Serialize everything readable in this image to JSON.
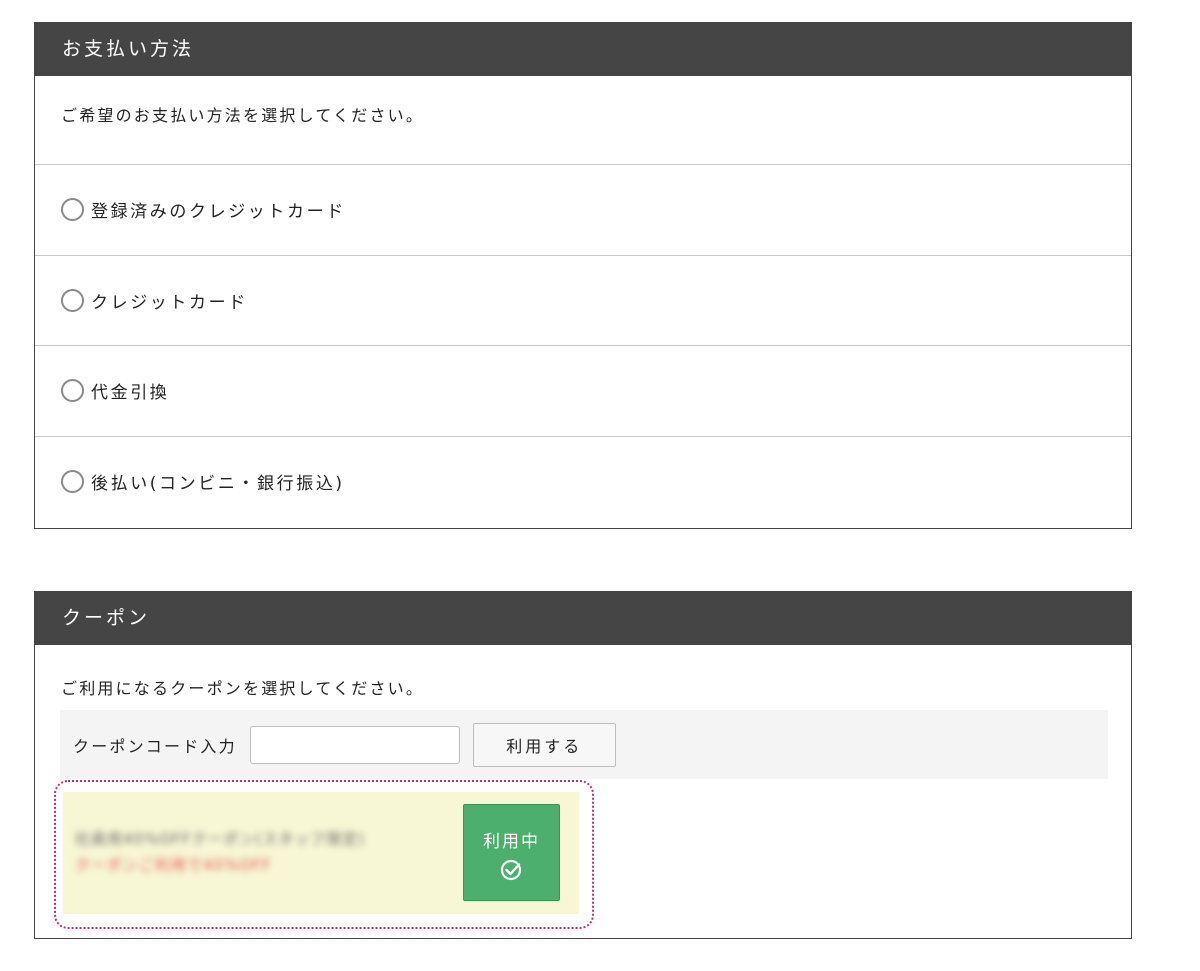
{
  "payment": {
    "title": "お支払い方法",
    "intro": "ご希望のお支払い方法を選択してください。",
    "options": [
      {
        "label": "登録済みのクレジットカード"
      },
      {
        "label": "クレジットカード"
      },
      {
        "label": "代金引換"
      },
      {
        "label": "後払い(コンビニ・銀行振込)"
      }
    ]
  },
  "coupon": {
    "title": "クーポン",
    "intro": "ご利用になるクーポンを選択してください。",
    "code_label": "クーポンコード入力",
    "code_value": "",
    "apply_label": "利用する",
    "selected": {
      "name": "社員用40%OFFクーポン(スタッフ限定)",
      "description": "クーポンご利用で40%OFF",
      "status_label": "利用中"
    }
  },
  "colors": {
    "header_bg": "#454545",
    "in_use_green": "#4caf6e",
    "selected_border": "#c8286e",
    "coupon_bg": "#f7f6d5"
  }
}
